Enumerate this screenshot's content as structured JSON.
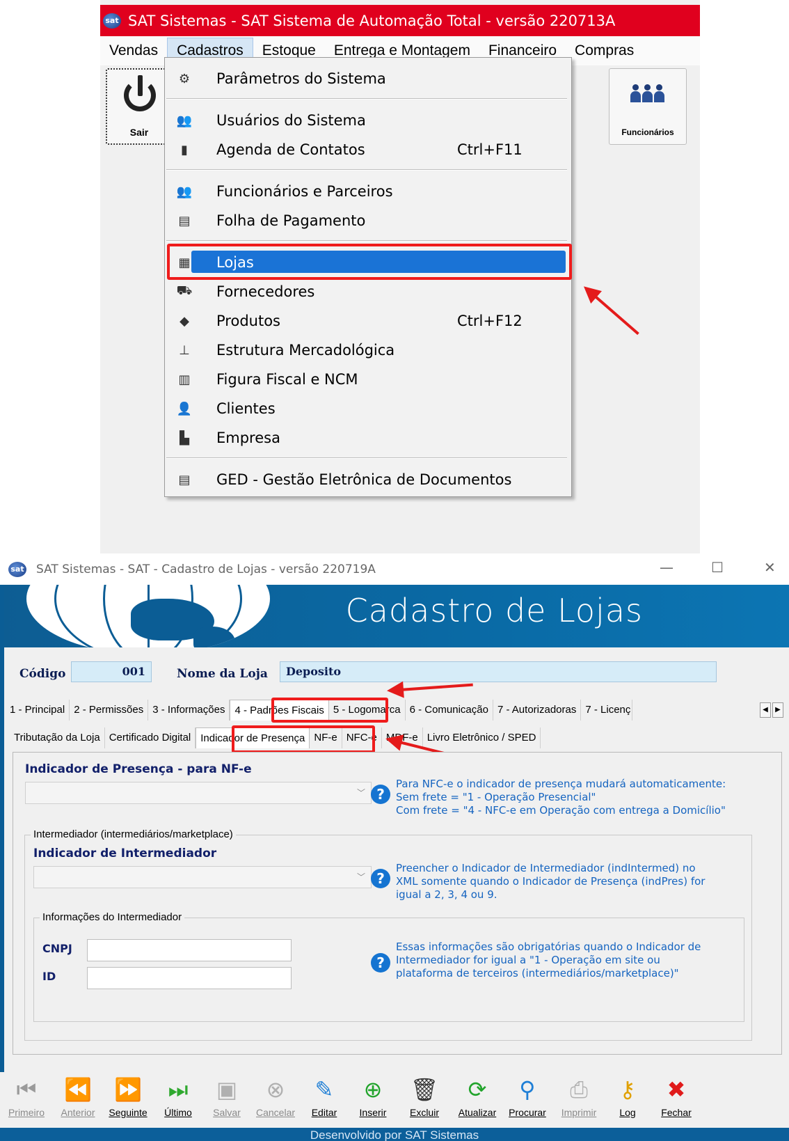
{
  "top_window": {
    "title": "SAT Sistemas - SAT Sistema de Automação Total - versão 220713A",
    "logo_text": "sat",
    "menubar": [
      "Vendas",
      "Cadastros",
      "Estoque",
      "Entrega e Montagem",
      "Financeiro",
      "Compras"
    ],
    "toolbar": {
      "exit_label": "Sair",
      "employees_label": "Funcionários"
    },
    "cadastros_menu": [
      {
        "label": "Parâmetros do Sistema",
        "shortcut": "",
        "icon": "gear-icon"
      },
      {
        "label": "Usuários do Sistema",
        "shortcut": "",
        "icon": "users-icon"
      },
      {
        "label": "Agenda de Contatos",
        "shortcut": "Ctrl+F11",
        "icon": "contacts-book-icon"
      },
      {
        "label": "Funcionários e Parceiros",
        "shortcut": "",
        "icon": "employees-icon"
      },
      {
        "label": "Folha de Pagamento",
        "shortcut": "",
        "icon": "payroll-icon"
      },
      {
        "label": "Lojas",
        "shortcut": "",
        "icon": "store-icon",
        "selected": true
      },
      {
        "label": "Fornecedores",
        "shortcut": "",
        "icon": "truck-icon"
      },
      {
        "label": "Produtos",
        "shortcut": "Ctrl+F12",
        "icon": "products-icon"
      },
      {
        "label": "Estrutura Mercadológica",
        "shortcut": "",
        "icon": "hierarchy-icon"
      },
      {
        "label": "Figura Fiscal e NCM",
        "shortcut": "",
        "icon": "barcode-icon"
      },
      {
        "label": "Clientes",
        "shortcut": "",
        "icon": "clients-icon"
      },
      {
        "label": "Empresa",
        "shortcut": "",
        "icon": "company-icon"
      },
      {
        "label": "GED - Gestão Eletrônica de Documentos",
        "shortcut": "",
        "icon": "document-icon"
      }
    ]
  },
  "lojas_window": {
    "title": "SAT Sistemas - SAT - Cadastro de Lojas - versão 220719A",
    "banner_title": "Cadastro de Lojas",
    "codigo_label": "Código",
    "codigo_value": "001",
    "nome_label": "Nome da Loja",
    "nome_value": "Deposito",
    "main_tabs": [
      "1 - Principal",
      "2 - Permissões",
      "3 - Informações",
      "4 - Padrões Fiscais",
      "5 - Logomarca",
      "6 - Comunicação",
      "7 - Autorizadoras",
      "7 - Licenç"
    ],
    "sub_tabs": [
      "Tributação da Loja",
      "Certificado Digital",
      "Indicador de Presença",
      "NF-e",
      "NFC-e",
      "MDF-e",
      "Livro Eletrônico / SPED"
    ],
    "presence_heading": "Indicador de Presença - para NF-e",
    "presence_help": [
      "Para NFC-e o indicador de presença mudará automaticamente:",
      "Sem frete = \"1 - Operação Presencial\"",
      "Com frete = \"4 - NFC-e em Operação com entrega a Domicílio\""
    ],
    "intermediary_group": "Intermediador (intermediários/marketplace)",
    "intermediary_heading": "Indicador de Intermediador",
    "intermediary_help": [
      "Preencher o Indicador de Intermediador (indIntermed) no",
      "XML somente quando o Indicador de Presença (indPres) for",
      "igual a 2, 3, 4 ou 9."
    ],
    "info_group": "Informações do Intermediador",
    "cnpj_label": "CNPJ",
    "id_label": "ID",
    "info_help": [
      "Essas informações são obrigatórias quando o Indicador de",
      "Intermediador for igual a \"1 - Operação em site ou",
      "plataforma de terceiros (intermediários/marketplace)\""
    ],
    "nav_buttons": [
      {
        "label": "Primeiro",
        "icon": "first-record-icon",
        "glyph": "⏮",
        "color": "#9a9a9a",
        "enabled": false
      },
      {
        "label": "Anterior",
        "icon": "previous-record-icon",
        "glyph": "⏪",
        "color": "#9a9a9a",
        "enabled": false
      },
      {
        "label": "Seguinte",
        "icon": "next-record-icon",
        "glyph": "⏩",
        "color": "#2fa82f",
        "enabled": true
      },
      {
        "label": "Último",
        "icon": "last-record-icon",
        "glyph": "⏭",
        "color": "#2fa82f",
        "enabled": true
      },
      {
        "label": "Salvar",
        "icon": "save-icon",
        "glyph": "▣",
        "color": "#b0b0b0",
        "enabled": false
      },
      {
        "label": "Cancelar",
        "icon": "cancel-icon",
        "glyph": "⊗",
        "color": "#b0b0b0",
        "enabled": false
      },
      {
        "label": "Editar",
        "icon": "edit-icon",
        "glyph": "✎",
        "color": "#1f7fd6",
        "enabled": true
      },
      {
        "label": "Inserir",
        "icon": "add-icon",
        "glyph": "⊕",
        "color": "#22a42c",
        "enabled": true
      },
      {
        "label": "Excluir",
        "icon": "trash-icon",
        "glyph": "🗑",
        "color": "#333333",
        "enabled": true
      },
      {
        "label": "Atualizar",
        "icon": "refresh-icon",
        "glyph": "⟳",
        "color": "#22a42c",
        "enabled": true
      },
      {
        "label": "Procurar",
        "icon": "search-icon",
        "glyph": "⚲",
        "color": "#1f7fd6",
        "enabled": true
      },
      {
        "label": "Imprimir",
        "icon": "print-icon",
        "glyph": "⎙",
        "color": "#b0b0b0",
        "enabled": false
      },
      {
        "label": "Log",
        "icon": "key-icon",
        "glyph": "⚷",
        "color": "#e0a000",
        "enabled": true
      },
      {
        "label": "Fechar",
        "icon": "close-icon",
        "glyph": "✖",
        "color": "#e01b1b",
        "enabled": true
      }
    ],
    "status_text": "Desenvolvido por SAT Sistemas"
  }
}
